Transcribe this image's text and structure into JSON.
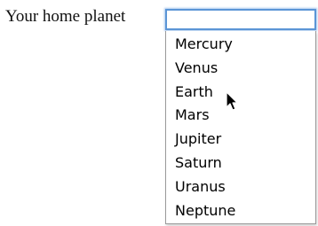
{
  "form": {
    "label": "Your home planet",
    "input_value": "",
    "options": [
      "Mercury",
      "Venus",
      "Earth",
      "Mars",
      "Jupiter",
      "Saturn",
      "Uranus",
      "Neptune"
    ]
  },
  "colors": {
    "focus_border": "#5b95d6",
    "dropdown_border": "#9a9a9a"
  },
  "cursor": {
    "icon": "arrow-pointer-icon"
  }
}
